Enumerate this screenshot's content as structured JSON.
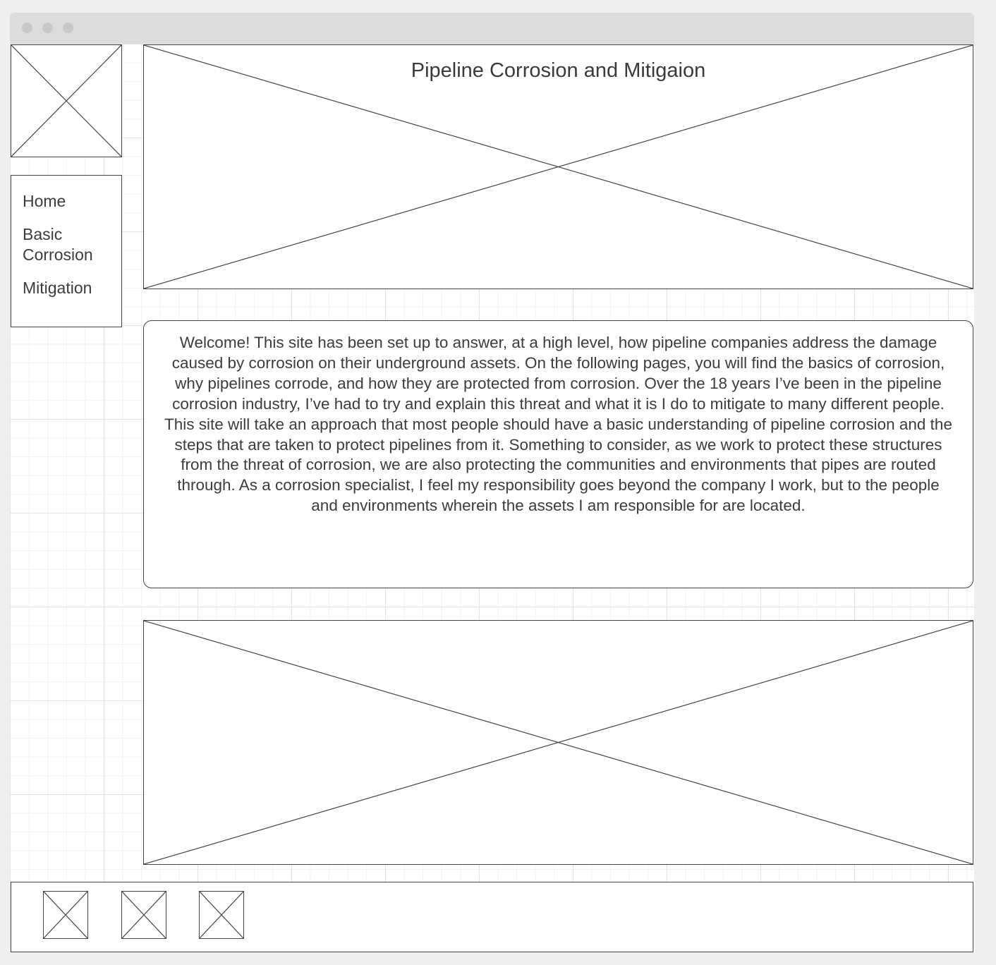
{
  "header": {
    "title": "Pipeline Corrosion and Mitigaion"
  },
  "nav": {
    "items": [
      {
        "label": "Home"
      },
      {
        "label": "Basic Corrosion"
      },
      {
        "label": "Mitigation"
      }
    ]
  },
  "main": {
    "welcome_text": "Welcome! This site has been set up to answer, at a high level, how pipeline companies address the damage caused by corrosion on their underground assets. On the following pages, you will find the basics of corrosion, why pipelines corrode, and how they are protected from corrosion. Over the 18 years I’ve been in the pipeline corrosion industry, I’ve had to try and explain this threat and what it is I do to mitigate to many different people. This site will take an approach that most people should have a basic understanding of pipeline corrosion and the steps that are taken to protect pipelines from it. Something to consider, as we work to protect these structures from the threat of corrosion, we are also protecting the communities and environments that pipes are routed through. As a corrosion specialist, I feel my responsibility goes beyond the company I work, but to the people and environments wherein the assets I am responsible for are located."
  },
  "footer": {
    "icons": [
      "social-icon-placeholder",
      "social-icon-placeholder",
      "social-icon-placeholder"
    ]
  },
  "colors": {
    "page_background": "#efefef",
    "titlebar": "#dcdcdc",
    "stroke": "#444444",
    "text": "#3c3c3c"
  }
}
